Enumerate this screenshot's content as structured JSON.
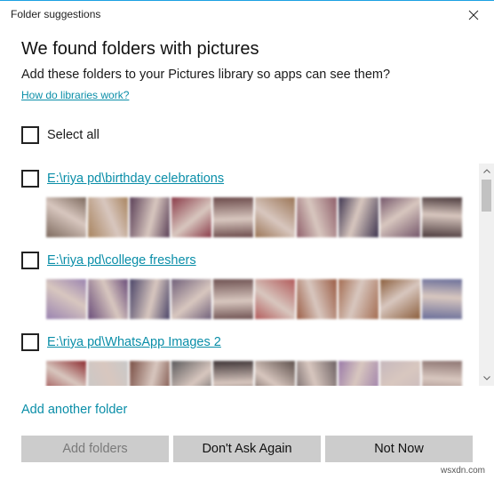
{
  "window": {
    "title": "Folder suggestions"
  },
  "header": {
    "heading": "We found folders with pictures",
    "subtitle": "Add these folders to your Pictures library so apps can see them?",
    "help_link": "How do libraries work?"
  },
  "select_all": {
    "label": "Select all",
    "checked": false
  },
  "folders": [
    {
      "path": "E:\\riya pd\\birthday celebrations",
      "checked": false,
      "thumb_colors": [
        "#7d6a5e",
        "#a8845f",
        "#5a3f57",
        "#8a3a48",
        "#6b4a4a",
        "#9b7556",
        "#8f5f6a",
        "#3e3550",
        "#74566a",
        "#4c3b3d"
      ]
    },
    {
      "path": "E:\\riya pd\\college freshers",
      "checked": false,
      "thumb_colors": [
        "#9a83b0",
        "#6a4d7a",
        "#4a4468",
        "#70607a",
        "#6f5252",
        "#b25a5a",
        "#9b5d45",
        "#a46d52",
        "#8b5e3c",
        "#6b6f9a"
      ]
    },
    {
      "path": "E:\\riya pd\\WhatsApp Images 2",
      "checked": false,
      "thumb_colors": [
        "#8c2a2e",
        "#c8c8c8",
        "#7a4f45",
        "#5b5a5c",
        "#3e3436",
        "#5d4f4b",
        "#6e6264",
        "#9a7aa8",
        "#c6b8bd",
        "#8d7572"
      ]
    }
  ],
  "footer": {
    "add_another": "Add another folder",
    "buttons": {
      "add_folders": "Add folders",
      "dont_ask": "Don't Ask Again",
      "not_now": "Not Now"
    }
  },
  "watermark": "wsxdn.com",
  "colors": {
    "accent": "#0a8ea8",
    "button_bg": "#cccccc"
  }
}
